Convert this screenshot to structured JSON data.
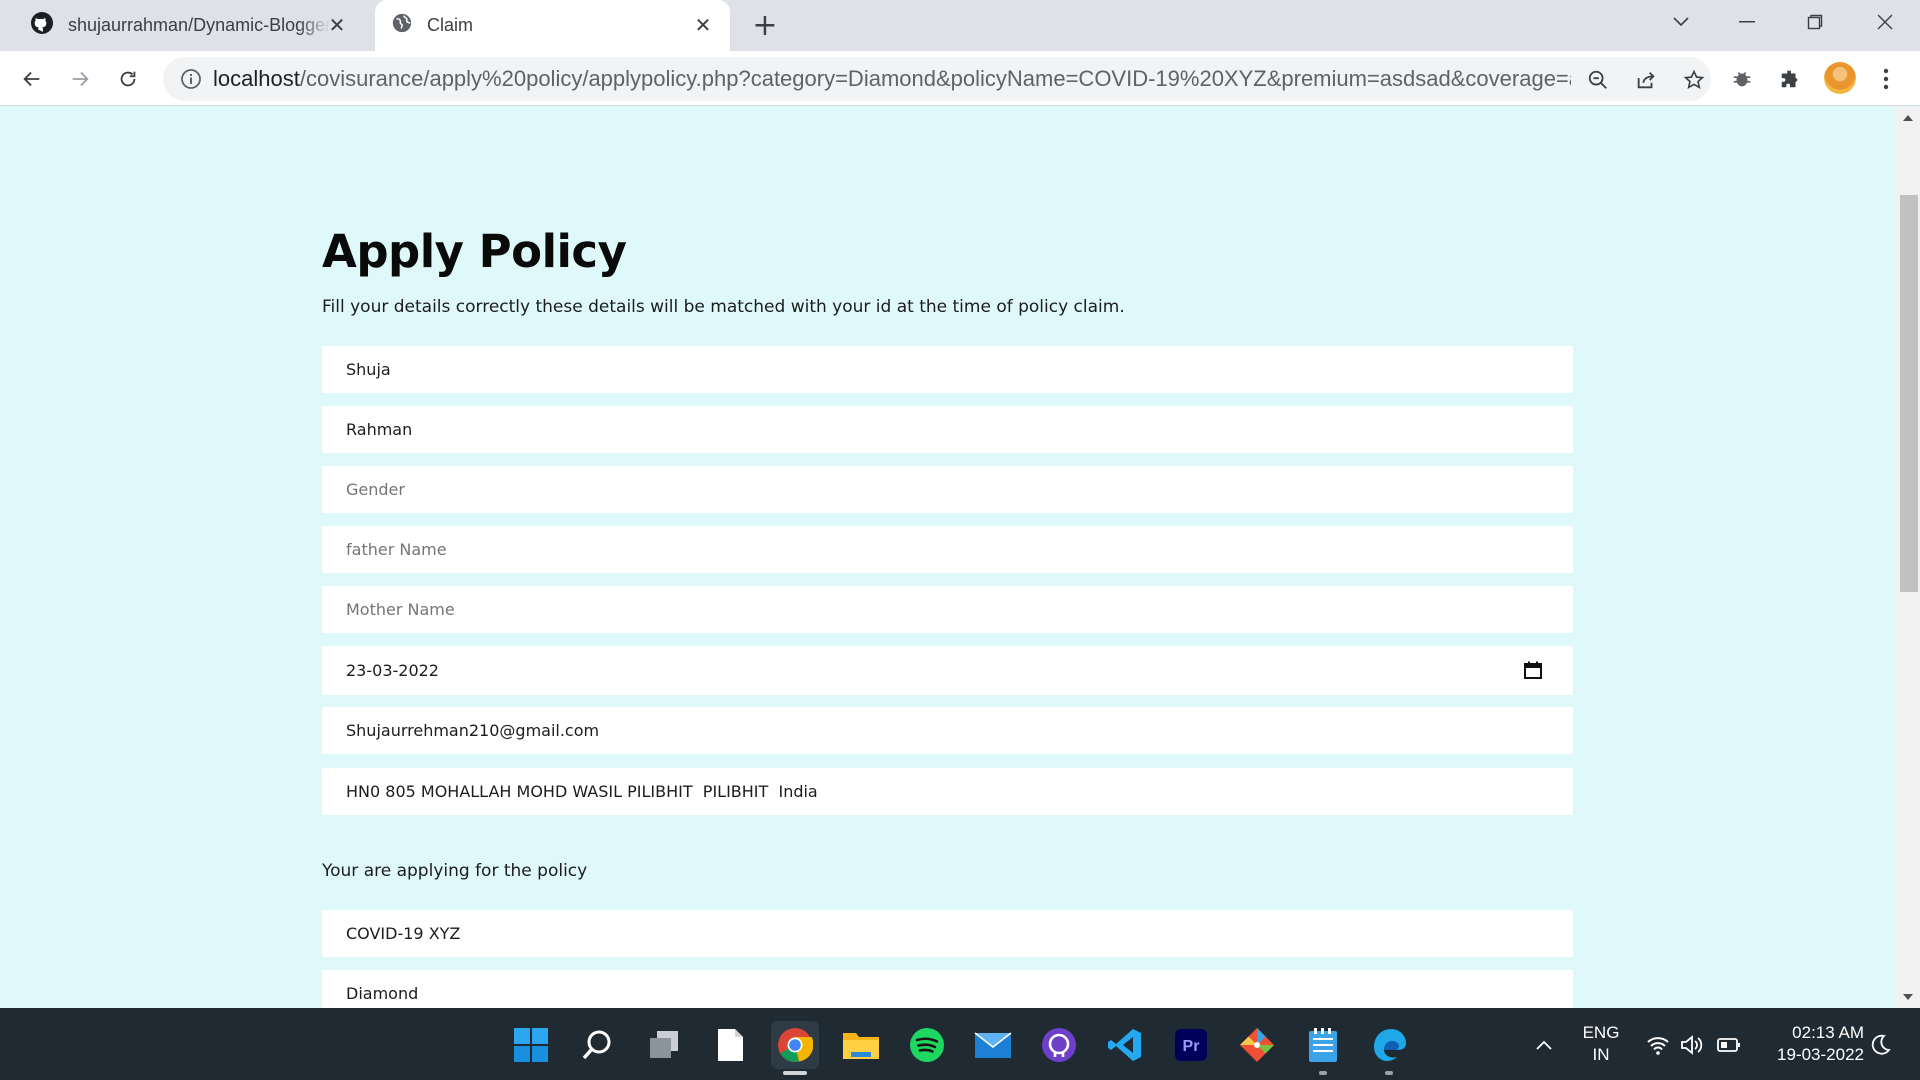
{
  "browser": {
    "tabs": [
      {
        "label": "shujaurrahman/Dynamic-Blogger",
        "icon": "github-icon",
        "active": false
      },
      {
        "label": "Claim",
        "icon": "globe-icon",
        "active": true
      }
    ],
    "url_host": "localhost",
    "url_path": "/covisurance/apply%20policy/applypolicy.php?category=Diamond&policyName=COVID-19%20XYZ&premium=asdsad&coverage=as..."
  },
  "form": {
    "title": "Apply Policy",
    "description": "Fill your details correctly these details will be matched with your id at the time of policy claim.",
    "fields": {
      "first_name": {
        "value": "Shuja"
      },
      "last_name": {
        "value": "Rahman"
      },
      "gender": {
        "placeholder": "Gender"
      },
      "father_name": {
        "placeholder": "father Name"
      },
      "mother_name": {
        "placeholder": "Mother Name"
      },
      "dob": {
        "value": "23-03-2022"
      },
      "email": {
        "value": "Shujaurrehman210@gmail.com"
      },
      "address": {
        "value": "HN0 805 MOHALLAH MOHD WASIL PILIBHIT  PILIBHIT  India"
      }
    },
    "policy_section_label": "Your are applying for the policy",
    "policy_name": "COVID-19 XYZ",
    "policy_category": "Diamond"
  },
  "taskbar": {
    "apps": [
      "windows-start-icon",
      "search-icon",
      "task-view-icon",
      "file-icon",
      "chrome-icon",
      "file-explorer-icon",
      "spotify-icon",
      "mail-icon",
      "github-desktop-icon",
      "vscode-icon",
      "premiere-pro-icon",
      "git-icon",
      "notepad-icon",
      "edge-icon"
    ],
    "language_line1": "ENG",
    "language_line2": "IN",
    "time": "02:13 AM",
    "date": "19-03-2022"
  },
  "colors": {
    "page_background": "#dff9fb",
    "taskbar": "#1f2a33",
    "tabstrip": "#dee1e6"
  }
}
